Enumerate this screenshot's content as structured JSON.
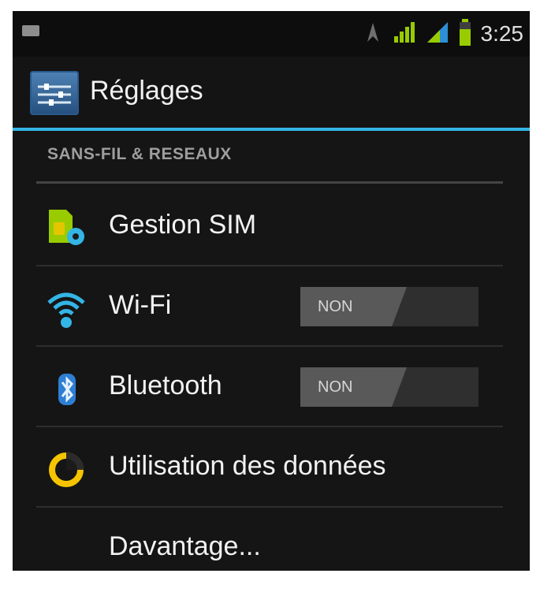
{
  "status_bar": {
    "time": "3:25",
    "icons": [
      "notification-icon",
      "signal-strength-icon",
      "signal-strength-2-icon",
      "battery-icon",
      "gps-icon"
    ]
  },
  "action_bar": {
    "title": "Réglages",
    "icon": "settings-app-icon"
  },
  "section": {
    "header": "SANS-FIL & RESEAUX"
  },
  "items": [
    {
      "label": "Gestion SIM",
      "icon": "sim-card-icon"
    },
    {
      "label": "Wi-Fi",
      "icon": "wifi-icon",
      "toggle": "NON"
    },
    {
      "label": "Bluetooth",
      "icon": "bluetooth-icon",
      "toggle": "NON"
    },
    {
      "label": "Utilisation des données",
      "icon": "data-usage-icon"
    },
    {
      "label": "Davantage..."
    }
  ],
  "colors": {
    "accent": "#33b5e5",
    "background": "#151515",
    "text": "#f2f2f2",
    "toggle_off": "#595959"
  }
}
